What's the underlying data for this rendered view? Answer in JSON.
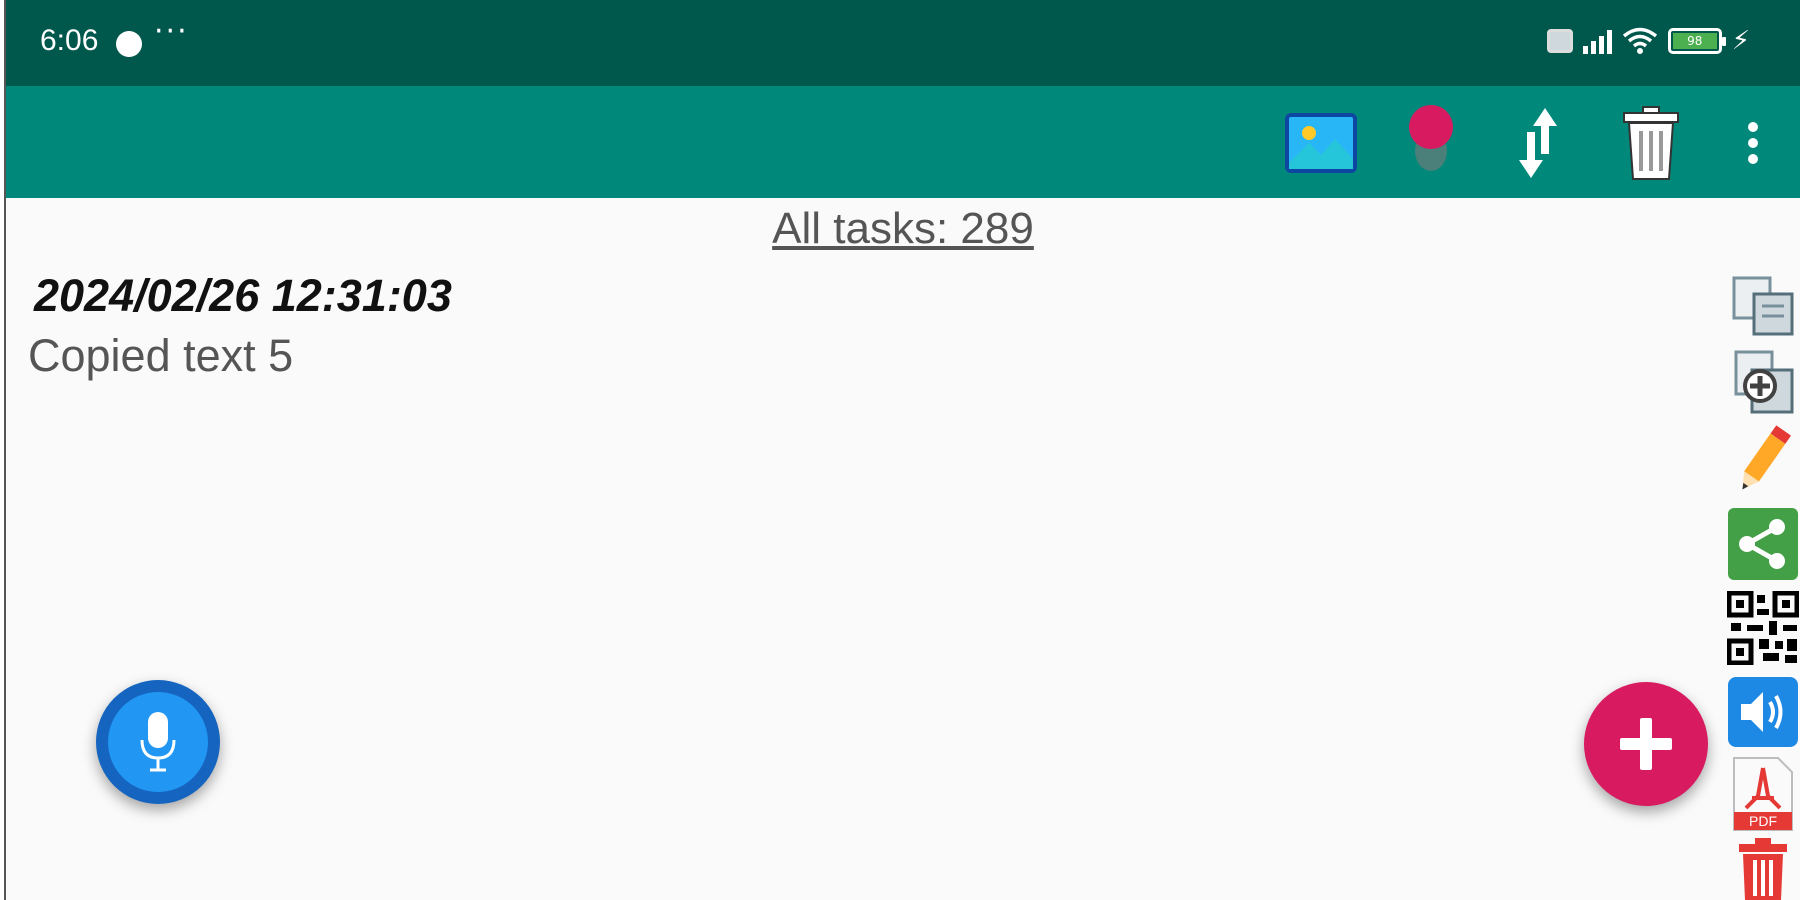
{
  "status_bar": {
    "time": "6:06",
    "more": "···",
    "battery_level": "98"
  },
  "toolbar": {
    "icons": [
      "image-icon",
      "record-dot-icon",
      "sort-icon",
      "trash-icon",
      "more-vert-icon"
    ]
  },
  "header": {
    "all_tasks_label": "All tasks: 289"
  },
  "task": {
    "date": "2024/02/26 12:31:03",
    "text": "Copied text 5"
  },
  "side_actions": [
    "copy-icon",
    "add-copy-icon",
    "pencil-icon",
    "share-icon",
    "qr-code-icon",
    "speaker-icon",
    "pdf-icon",
    "delete-icon"
  ],
  "colors": {
    "status_bar": "#00574b",
    "toolbar": "#00897b",
    "accent": "#d81b60",
    "mic_fab": "#1565c0"
  }
}
